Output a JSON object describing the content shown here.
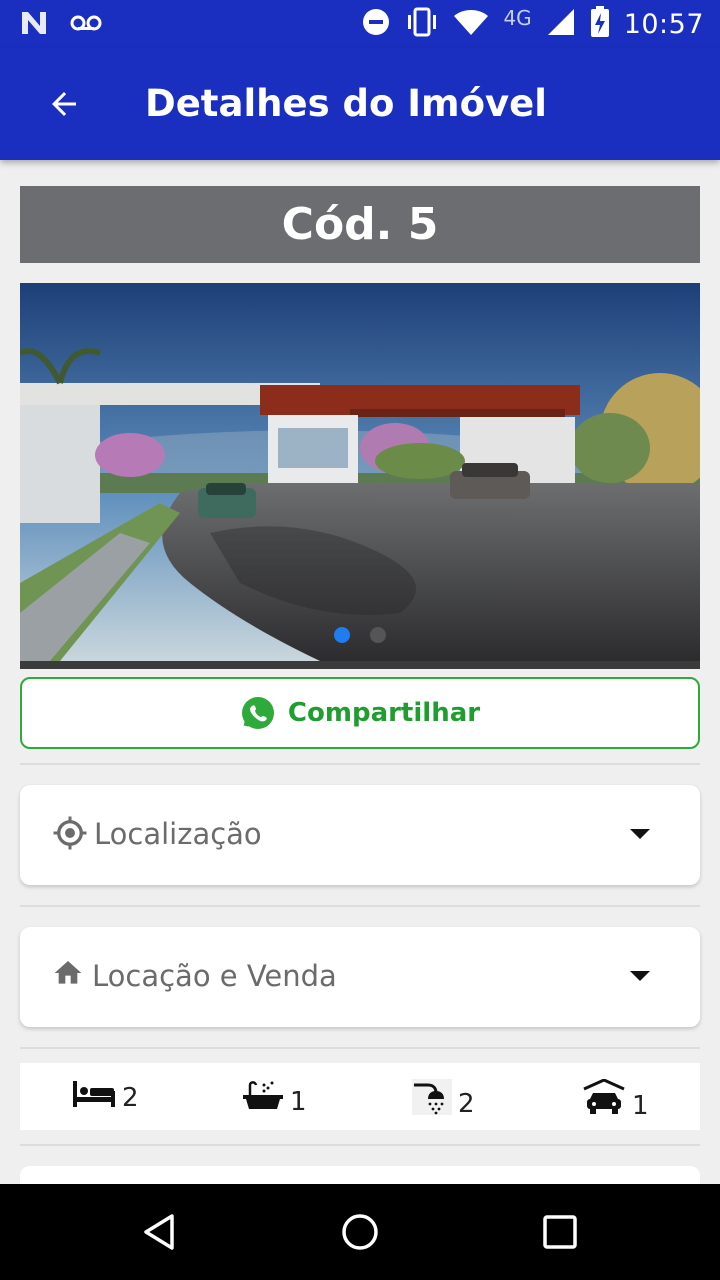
{
  "status_bar": {
    "time": "10:57",
    "network": "4G",
    "left_icons": [
      "n-notification-icon",
      "voicemail-icon"
    ],
    "right_icons": [
      "do-not-disturb-icon",
      "vibrate-icon",
      "wifi-icon",
      "signal-icon",
      "battery-charging-icon"
    ]
  },
  "app_bar": {
    "title": "Detalhes do Imóvel",
    "back_icon": "arrow-back-icon"
  },
  "property": {
    "code_label": "Cód. 5"
  },
  "gallery": {
    "current_index": 1,
    "total_images": 2,
    "active_dot_color": "#1e7ef0"
  },
  "share": {
    "label": "Compartilhar",
    "icon": "whatsapp-icon",
    "color": "#2eaa3a"
  },
  "sections": [
    {
      "label": "Localização",
      "icon": "location-target-icon"
    },
    {
      "label": "Locação e Venda",
      "icon": "home-icon"
    }
  ],
  "features": [
    {
      "icon": "bed-icon",
      "value": "2"
    },
    {
      "icon": "bathtub-icon",
      "value": "1"
    },
    {
      "icon": "shower-icon",
      "value": "2"
    },
    {
      "icon": "garage-icon",
      "value": "1"
    }
  ],
  "colors": {
    "primary": "#1a2fbf",
    "banner": "#6c6d70",
    "share_green": "#2eaa3a"
  },
  "nav_bar": {
    "icons": [
      "back-triangle-icon",
      "home-circle-icon",
      "recents-square-icon"
    ]
  }
}
